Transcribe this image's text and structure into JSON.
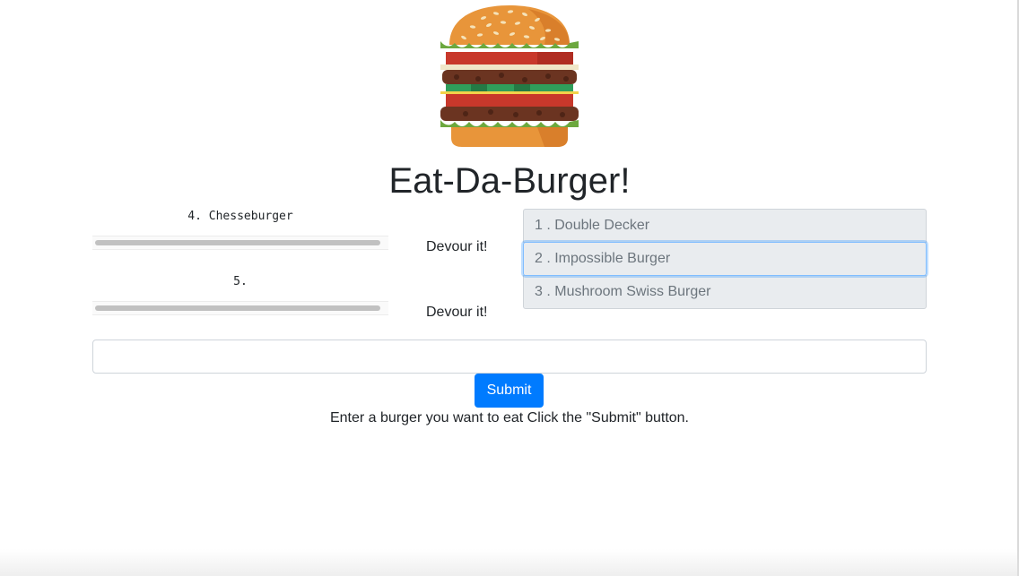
{
  "header": {
    "logo_icon": "hamburger-icon",
    "title": "Eat-Da-Burger!"
  },
  "uneaten_burgers": [
    {
      "text": "4. Chesseburger",
      "action_label": "Devour it!"
    },
    {
      "text": "5.",
      "action_label": "Devour it!"
    }
  ],
  "devoured_burgers": [
    {
      "text": "1 . Double Decker"
    },
    {
      "text": "2 . Impossible Burger"
    },
    {
      "text": "3 . Mushroom Swiss Burger"
    }
  ],
  "form": {
    "input_value": "",
    "input_placeholder": "",
    "submit_label": "Submit",
    "instructions": "Enter a burger you want to eat Click the \"Submit\" button."
  },
  "colors": {
    "primary": "#007bff",
    "list_bg": "#e9ecef",
    "list_text": "#6c757d",
    "focus_ring": "#80bdff"
  }
}
